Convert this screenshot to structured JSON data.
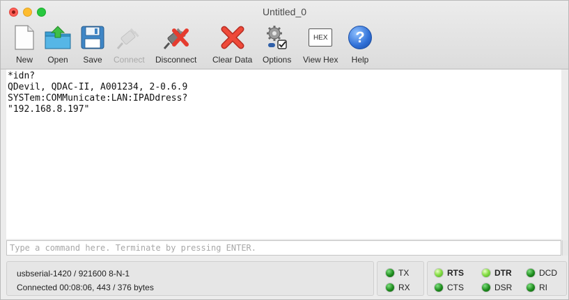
{
  "window": {
    "title": "Untitled_0"
  },
  "toolbar": {
    "items": [
      {
        "label": "New",
        "icon": "new-document-icon",
        "enabled": true
      },
      {
        "label": "Open",
        "icon": "open-folder-icon",
        "enabled": true
      },
      {
        "label": "Save",
        "icon": "save-floppy-icon",
        "enabled": true
      },
      {
        "label": "Connect",
        "icon": "connect-plug-icon",
        "enabled": false
      },
      {
        "label": "Disconnect",
        "icon": "disconnect-plug-icon",
        "enabled": true
      },
      {
        "label": "Clear Data",
        "icon": "clear-x-icon",
        "enabled": true
      },
      {
        "label": "Options",
        "icon": "options-gears-icon",
        "enabled": true
      },
      {
        "label": "View Hex",
        "icon": "hex-icon",
        "enabled": true
      },
      {
        "label": "Help",
        "icon": "help-icon",
        "enabled": true
      }
    ],
    "hex_icon_text": "HEX",
    "help_icon_text": "?"
  },
  "terminal": {
    "lines": [
      "*idn?",
      "QDevil, QDAC-II, A001234, 2-0.6.9",
      "SYSTem:COMMunicate:LAN:IPADdress?",
      "\"192.168.8.197\""
    ]
  },
  "command_input": {
    "value": "",
    "placeholder": "Type a command here. Terminate by pressing ENTER."
  },
  "status": {
    "port": "usbserial-1420 / 921600 8-N-1",
    "connection": "Connected 00:08:06, 443 / 376 bytes",
    "signals": {
      "tx": "TX",
      "rx": "RX",
      "rts": "RTS",
      "cts": "CTS",
      "dtr": "DTR",
      "dsr": "DSR",
      "dcd": "DCD",
      "ri": "RI"
    }
  },
  "colors": {
    "led_on": "#1d8b1d",
    "led_bright": "#8be04a",
    "clear_red": "#e53c2f",
    "help_blue": "#2f6fd6"
  }
}
